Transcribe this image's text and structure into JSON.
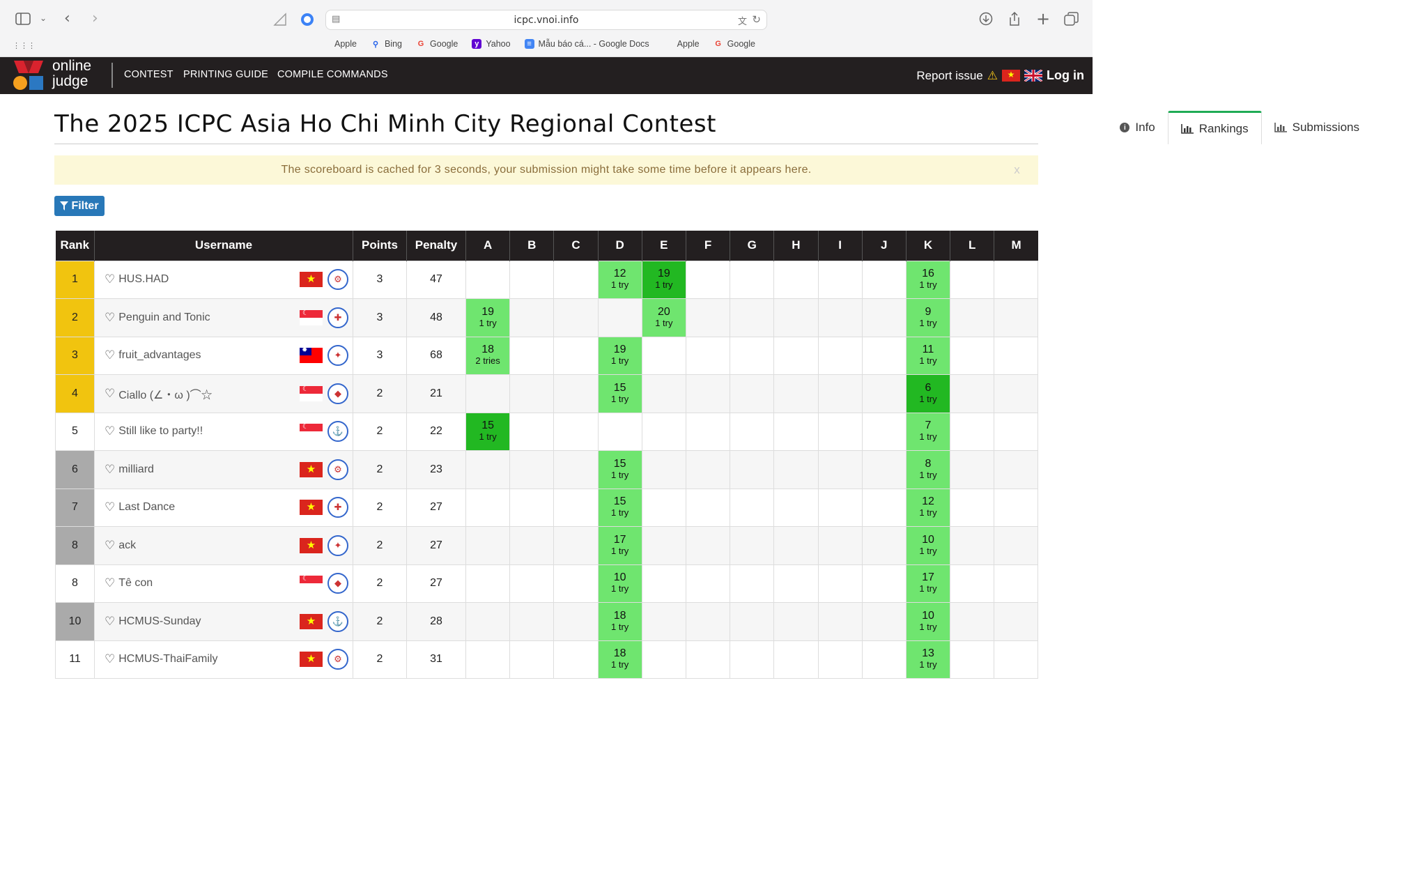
{
  "browser": {
    "url": "icpc.vnoi.info",
    "bookmarks": [
      {
        "icon": "apple-icon",
        "label": "Apple"
      },
      {
        "icon": "bing-icon",
        "label": "Bing"
      },
      {
        "icon": "google-icon",
        "label": "Google"
      },
      {
        "icon": "yahoo-icon",
        "label": "Yahoo"
      },
      {
        "icon": "docs-icon",
        "label": "Mẫu báo cá... - Google Docs"
      },
      {
        "icon": "apple-icon",
        "label": "Apple"
      },
      {
        "icon": "google-icon",
        "label": "Google"
      }
    ]
  },
  "site": {
    "logo_line1": "online",
    "logo_line2": "judge",
    "nav": [
      "CONTEST",
      "PRINTING GUIDE",
      "COMPILE COMMANDS"
    ],
    "report_issue": "Report issue",
    "warning_glyph": "⚠",
    "login": "Log in"
  },
  "page": {
    "title": "The 2025 ICPC Asia Ho Chi Minh City Regional Contest",
    "tabs": {
      "info": "Info",
      "rankings": "Rankings",
      "submissions": "Submissions"
    },
    "notice": "The scoreboard is cached for 3 seconds, your submission might take some time before it appears here.",
    "notice_close": "x",
    "filter_label": "Filter"
  },
  "table": {
    "headers": {
      "rank": "Rank",
      "username": "Username",
      "points": "Points",
      "penalty": "Penalty"
    },
    "problems": [
      "A",
      "B",
      "C",
      "D",
      "E",
      "F",
      "G",
      "H",
      "I",
      "J",
      "K",
      "L",
      "M"
    ],
    "rows": [
      {
        "rank": "1",
        "rank_style": "gold",
        "name": "HUS.HAD",
        "flag": "vn",
        "points": "3",
        "penalty": "47",
        "cells": {
          "D": {
            "t": "12",
            "s": "1 try",
            "first": false
          },
          "E": {
            "t": "19",
            "s": "1 try",
            "first": true
          },
          "K": {
            "t": "16",
            "s": "1 try",
            "first": false
          }
        }
      },
      {
        "rank": "2",
        "rank_style": "gold",
        "name": "Penguin and Tonic",
        "flag": "sg",
        "points": "3",
        "penalty": "48",
        "cells": {
          "A": {
            "t": "19",
            "s": "1 try",
            "first": false
          },
          "E": {
            "t": "20",
            "s": "1 try",
            "first": false
          },
          "K": {
            "t": "9",
            "s": "1 try",
            "first": false
          }
        }
      },
      {
        "rank": "3",
        "rank_style": "gold",
        "name": "fruit_advantages",
        "flag": "tw",
        "points": "3",
        "penalty": "68",
        "cells": {
          "A": {
            "t": "18",
            "s": "2 tries",
            "first": false
          },
          "D": {
            "t": "19",
            "s": "1 try",
            "first": false
          },
          "K": {
            "t": "11",
            "s": "1 try",
            "first": false
          }
        }
      },
      {
        "rank": "4",
        "rank_style": "gold",
        "name": "Ciallo (∠・ω )⌒☆",
        "flag": "sg",
        "points": "2",
        "penalty": "21",
        "cells": {
          "D": {
            "t": "15",
            "s": "1 try",
            "first": false
          },
          "K": {
            "t": "6",
            "s": "1 try",
            "first": true
          }
        }
      },
      {
        "rank": "5",
        "rank_style": "plain",
        "name": "Still like to party!!",
        "flag": "sg",
        "points": "2",
        "penalty": "22",
        "cells": {
          "A": {
            "t": "15",
            "s": "1 try",
            "first": true
          },
          "K": {
            "t": "7",
            "s": "1 try",
            "first": false
          }
        }
      },
      {
        "rank": "6",
        "rank_style": "silver",
        "name": "milliard",
        "flag": "vn",
        "points": "2",
        "penalty": "23",
        "cells": {
          "D": {
            "t": "15",
            "s": "1 try",
            "first": false
          },
          "K": {
            "t": "8",
            "s": "1 try",
            "first": false
          }
        }
      },
      {
        "rank": "7",
        "rank_style": "silver",
        "name": "Last Dance",
        "flag": "vn",
        "points": "2",
        "penalty": "27",
        "cells": {
          "D": {
            "t": "15",
            "s": "1 try",
            "first": false
          },
          "K": {
            "t": "12",
            "s": "1 try",
            "first": false
          }
        }
      },
      {
        "rank": "8",
        "rank_style": "silver",
        "name": "ack",
        "flag": "vn",
        "points": "2",
        "penalty": "27",
        "cells": {
          "D": {
            "t": "17",
            "s": "1 try",
            "first": false
          },
          "K": {
            "t": "10",
            "s": "1 try",
            "first": false
          }
        }
      },
      {
        "rank": "8",
        "rank_style": "plain",
        "name": "Tê con",
        "flag": "sg",
        "points": "2",
        "penalty": "27",
        "cells": {
          "D": {
            "t": "10",
            "s": "1 try",
            "first": false
          },
          "K": {
            "t": "17",
            "s": "1 try",
            "first": false
          }
        }
      },
      {
        "rank": "10",
        "rank_style": "silver",
        "name": "HCMUS-Sunday",
        "flag": "vn",
        "points": "2",
        "penalty": "28",
        "cells": {
          "D": {
            "t": "18",
            "s": "1 try",
            "first": false
          },
          "K": {
            "t": "10",
            "s": "1 try",
            "first": false
          }
        }
      },
      {
        "rank": "11",
        "rank_style": "plain",
        "name": "HCMUS-ThaiFamily",
        "flag": "vn",
        "points": "2",
        "penalty": "31",
        "cells": {
          "D": {
            "t": "18",
            "s": "1 try",
            "first": false
          },
          "K": {
            "t": "13",
            "s": "1 try",
            "first": false
          }
        }
      }
    ]
  },
  "colors": {
    "accepted": "#6fe56f",
    "first_solve": "#22b822",
    "gold": "#f1c40f",
    "silver": "#aaaaaa",
    "nav_bg": "#231f20",
    "tab_active": "#1fab55",
    "filter": "#2878b8"
  }
}
